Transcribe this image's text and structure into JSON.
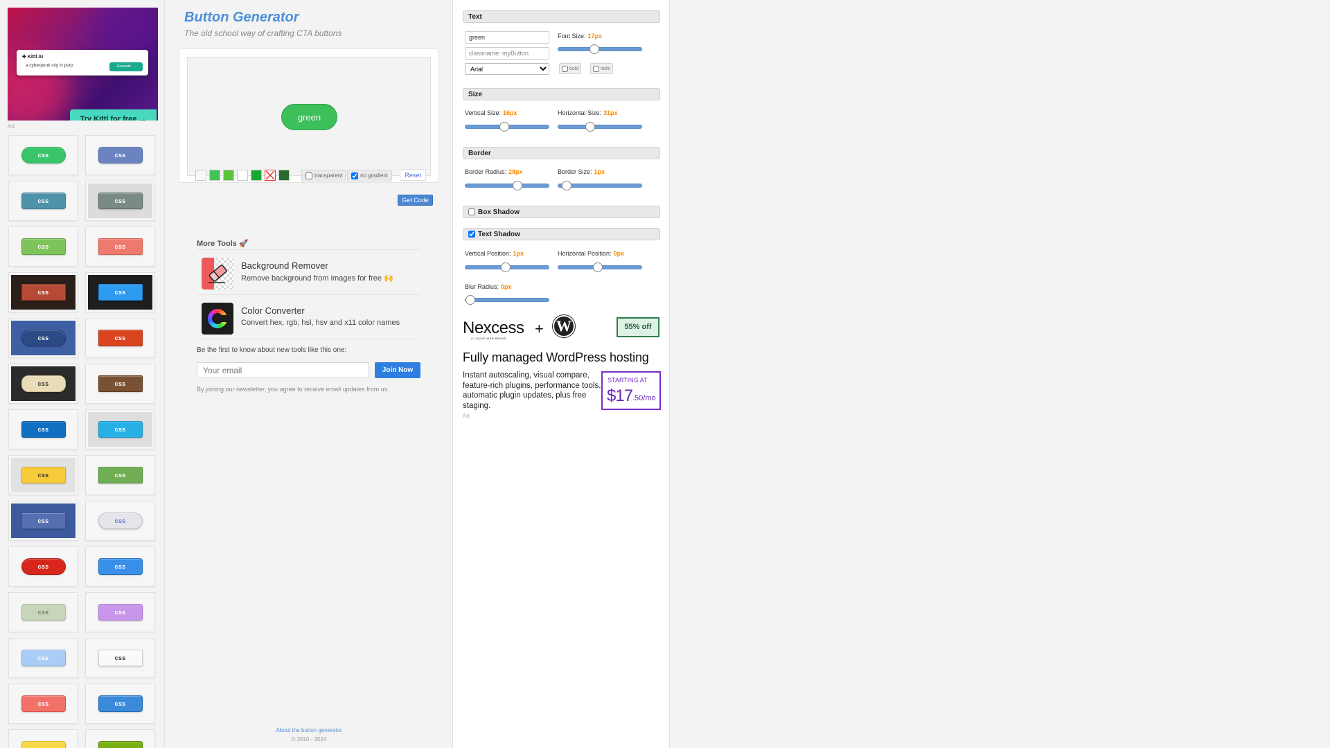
{
  "left_ad": {
    "brand": "✚ Kittl AI",
    "prompt": "a cyberpunk city in purp",
    "generate_label": "Generate →",
    "cta": "Try Kittl for free →",
    "ad_label": "Ad"
  },
  "gallery": {
    "tile_label": "css",
    "tiles": [
      {
        "bg": "#3ac56a",
        "color": "#fff",
        "radius": "14px",
        "tile_bg": "#f6f6f6",
        "border": "#2ea85a"
      },
      {
        "bg": "#6b84c0",
        "color": "#fff",
        "radius": "5px",
        "tile_bg": "#f6f6f6",
        "border": "#4e6aa8"
      },
      {
        "bg": "#4f93aa",
        "color": "#fff",
        "radius": "4px",
        "tile_bg": "#f6f6f6",
        "border": "#3e7b90"
      },
      {
        "bg": "#7a8a84",
        "color": "#fff",
        "radius": "3px",
        "tile_bg": "#dcdcdc",
        "border": "#5d6d67"
      },
      {
        "bg": "#7ec45a",
        "color": "#fff",
        "radius": "3px",
        "tile_bg": "#f6f6f6",
        "border": "#5fa442"
      },
      {
        "bg": "#ee7a6e",
        "color": "#fff",
        "radius": "2px",
        "tile_bg": "#f6f6f6",
        "border": "#d95e52"
      },
      {
        "bg": "#b64a34",
        "color": "#fff",
        "radius": "0px",
        "tile_bg": "#2b1f19",
        "border": "#8e3322"
      },
      {
        "bg": "#2d9bef",
        "color": "#fff",
        "radius": "2px",
        "tile_bg": "#1e1e1e",
        "border": "#1a7fd0"
      },
      {
        "bg": "#2c4a86",
        "color": "#fff",
        "radius": "14px",
        "tile_bg": "#3f5fa5",
        "border": "#1e3566"
      },
      {
        "bg": "#d9441e",
        "color": "#fff",
        "radius": "2px",
        "tile_bg": "#f6f6f6",
        "border": "#b33413"
      },
      {
        "bg": "#e9dcb6",
        "color": "#333",
        "radius": "10px",
        "tile_bg": "#2b2b2b",
        "border": "#c9b98e"
      },
      {
        "bg": "#7a5233",
        "color": "#fff",
        "radius": "2px",
        "tile_bg": "#f6f6f6",
        "border": "#5b3b22"
      },
      {
        "bg": "#0f6fc0",
        "color": "#fff",
        "radius": "3px",
        "tile_bg": "#f6f6f6",
        "border": "#0a5a9e"
      },
      {
        "bg": "#27b0e6",
        "color": "#fff",
        "radius": "3px",
        "tile_bg": "#dedede",
        "border": "#1b94c4"
      },
      {
        "bg": "#f7cc3a",
        "color": "#333",
        "radius": "3px",
        "tile_bg": "#e2e2e2",
        "border": "#d9a81e"
      },
      {
        "bg": "#6fae52",
        "color": "#fff",
        "radius": "2px",
        "tile_bg": "#f6f6f6",
        "border": "#528f39"
      },
      {
        "bg": "#566fb0",
        "color": "#fff",
        "radius": "0px",
        "tile_bg": "#3d5a9e",
        "border": "#3b5594"
      },
      {
        "bg": "#e4e4ea",
        "color": "#5a7ec4",
        "radius": "12px",
        "tile_bg": "#f6f6f6",
        "border": "#bfbfc8"
      },
      {
        "bg": "#d9261c",
        "color": "#fff",
        "radius": "14px",
        "tile_bg": "#f6f6f6",
        "border": "#a81a12"
      },
      {
        "bg": "#3a90e8",
        "color": "#fff",
        "radius": "4px",
        "tile_bg": "#f6f6f6",
        "border": "#1f6fc2"
      },
      {
        "bg": "#c7d6b8",
        "color": "#6f7f62",
        "radius": "4px",
        "tile_bg": "#f6f6f6",
        "border": "#a9bb96"
      },
      {
        "bg": "#c897ec",
        "color": "#fff",
        "radius": "3px",
        "tile_bg": "#f6f6f6",
        "border": "#ab79d3"
      },
      {
        "bg": "#a9cdf7",
        "color": "#fff",
        "radius": "4px",
        "tile_bg": "#f6f6f6",
        "border": "#86b1e3"
      },
      {
        "bg": "#fafafa",
        "color": "#333",
        "radius": "3px",
        "tile_bg": "#f6f6f6",
        "border": "#cfcfcf"
      },
      {
        "bg": "#f27169",
        "color": "#fff",
        "radius": "4px",
        "tile_bg": "#f6f6f6",
        "border": "#d4544c"
      },
      {
        "bg": "#3a8ad9",
        "color": "#fff",
        "radius": "4px",
        "tile_bg": "#f6f6f6",
        "border": "#2469b3"
      },
      {
        "bg": "#f8d94a",
        "color": "#333",
        "radius": "4px",
        "tile_bg": "#f6f6f6",
        "border": "#d7b72e"
      },
      {
        "bg": "#78b012",
        "color": "#fff",
        "radius": "3px",
        "tile_bg": "#f6f6f6",
        "border": "#5e8d0a"
      }
    ]
  },
  "header": {
    "title": "Button Generator",
    "subtitle": "The old school way of crafting CTA buttons"
  },
  "preview": {
    "button_text": "green",
    "swatches": [
      "#f7f7f7",
      "#44c257",
      "#5cc43b",
      "#ffffff",
      "#17a82f",
      "none",
      "#2b6a2e"
    ],
    "transparent_label": "transparent",
    "transparent_checked": false,
    "no_gradient_label": "no gradient",
    "no_gradient_checked": true,
    "reset_label": "Reset"
  },
  "get_code_label": "Get Code",
  "more_tools": {
    "title": "More Tools 🚀",
    "items": [
      {
        "name": "Background Remover",
        "desc": "Remove background from images for free 🙌"
      },
      {
        "name": "Color Converter",
        "desc": "Convert hex, rgb, hsl, hsv and x11 color names"
      }
    ]
  },
  "newsletter": {
    "title": "Be the first to know about new tools like this one:",
    "placeholder": "Your email",
    "join_label": "Join Now",
    "note": "By joining our newsletter, you agree to receive email updates from us."
  },
  "footer": {
    "about": "About the button generator",
    "copyright": "© 2010 - 2024"
  },
  "panel": {
    "text": {
      "title": "Text",
      "text_value": "green",
      "classname_placeholder": "classname: myButton",
      "font_family": "Arial",
      "font_size_label": "Font Size:",
      "font_size_value": "17px",
      "font_size_fraction": 0.42,
      "bold_label": "bold",
      "bold_checked": false,
      "italic_label": "italic",
      "italic_checked": false
    },
    "size": {
      "title": "Size",
      "vertical_label": "Vertical Size:",
      "vertical_value": "16px",
      "vertical_fraction": 0.46,
      "horizontal_label": "Horizontal Size:",
      "horizontal_value": "31px",
      "horizontal_fraction": 0.37
    },
    "border": {
      "title": "Border",
      "radius_label": "Border Radius:",
      "radius_value": "28px",
      "radius_fraction": 0.64,
      "size_label": "Border Size:",
      "size_value": "1px",
      "size_fraction": 0.05
    },
    "box_shadow": {
      "title": "Box Shadow",
      "checked": false
    },
    "text_shadow": {
      "title": "Text Shadow",
      "checked": true,
      "vpos_label": "Vertical Position:",
      "vpos_value": "1px",
      "vpos_fraction": 0.48,
      "hpos_label": "Horizontal Position:",
      "hpos_value": "0px",
      "hpos_fraction": 0.47,
      "blur_label": "Blur Radius:",
      "blur_value": "0px",
      "blur_fraction": 0.0
    }
  },
  "nexcess_ad": {
    "logo": "Nexcess",
    "logo_sub": "A LIQUID WEB BRAND",
    "plus": "+",
    "wp_glyph": "W",
    "badge": "55% off",
    "headline": "Fully managed WordPress hosting",
    "body": "Instant autoscaling, visual compare, feature-rich plugins, performance tools, automatic plugin updates, plus free staging.",
    "starting": "STARTING AT",
    "price": "$17",
    "cents": ".50/mo",
    "ad_label": "Ad"
  }
}
